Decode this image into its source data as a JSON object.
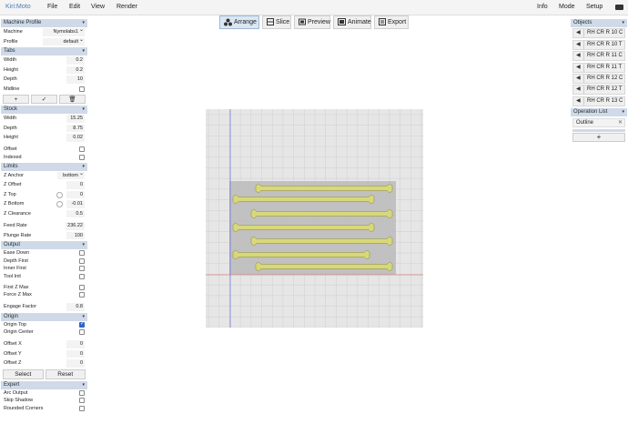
{
  "app": {
    "logo": "Kiri:Moto",
    "menu_left": [
      "File",
      "Edit",
      "View",
      "Render"
    ],
    "menu_right": [
      "Info",
      "Mode",
      "Setup"
    ]
  },
  "modes": [
    {
      "label": "Arrange",
      "icon": "arrange-icon",
      "active": true
    },
    {
      "label": "Slice",
      "icon": "slice-icon",
      "active": false
    },
    {
      "label": "Preview",
      "icon": "preview-icon",
      "active": false
    },
    {
      "label": "Animate",
      "icon": "animate-icon",
      "active": false
    },
    {
      "label": "Export",
      "icon": "export-icon",
      "active": false
    }
  ],
  "machine": {
    "title": "Machine Profile",
    "machine_label": "Machine",
    "machine_value": "Nymolabs1",
    "profile_label": "Profile",
    "profile_value": "default"
  },
  "tabs": {
    "title": "Tabs",
    "width_label": "Width",
    "width": "0.2",
    "height_label": "Height",
    "height": "0.2",
    "depth_label": "Depth",
    "depth": "10",
    "midline_label": "Midline",
    "add": "+",
    "apply": "✓",
    "delete": "🗑"
  },
  "stock": {
    "title": "Stock",
    "width_label": "Width",
    "width": "15.25",
    "depth_label": "Depth",
    "depth": "8.75",
    "height_label": "Height",
    "height": "0.02",
    "offset_label": "Offset",
    "indexed_label": "Indexed"
  },
  "limits": {
    "title": "Limits",
    "zanchor_label": "Z Anchor",
    "zanchor": "bottom",
    "zoffset_label": "Z Offset",
    "zoffset": "0",
    "ztop_label": "Z Top",
    "ztop": "0",
    "zbottom_label": "Z Bottom",
    "zbottom": "-0.01",
    "zclear_label": "Z Clearance",
    "zclear": "0.5",
    "feed_label": "Feed Rate",
    "feed": "236.22",
    "plunge_label": "Plunge Rate",
    "plunge": "100"
  },
  "output": {
    "title": "Output",
    "ease_label": "Ease Down",
    "depthfirst_label": "Depth First",
    "innerfirst_label": "Inner First",
    "toolinit_label": "Tool Init",
    "firstz_label": "First Z Max",
    "forcez_label": "Force Z Max",
    "engage_label": "Engage Factor",
    "engage": "0.8"
  },
  "origin": {
    "title": "Origin",
    "top_label": "Origin Top",
    "top_checked": true,
    "center_label": "Origin Center",
    "ox_label": "Offset X",
    "ox": "0",
    "oy_label": "Offset Y",
    "oy": "0",
    "oz_label": "Offset Z",
    "oz": "0",
    "select": "Select",
    "reset": "Reset"
  },
  "expert": {
    "title": "Expert",
    "arc_label": "Arc Output",
    "skip_label": "Skip Shadow",
    "round_label": "Rounded Corners"
  },
  "objects": {
    "title": "Objects",
    "items": [
      "RH CR R 10 C",
      "RH CR R 10 T",
      "RH CR R 11 C",
      "RH CR R 11 T",
      "RH CR R 12 C",
      "RH CR R 12 T",
      "RH CR R 13 C"
    ]
  },
  "oplist": {
    "title": "Operation List",
    "item": "Outline",
    "add": "+"
  },
  "colors": {
    "accent": "#4a7bb7",
    "section": "#cfd9e8",
    "part_fill": "#d8d87a",
    "stock": "#bdbdbd"
  }
}
